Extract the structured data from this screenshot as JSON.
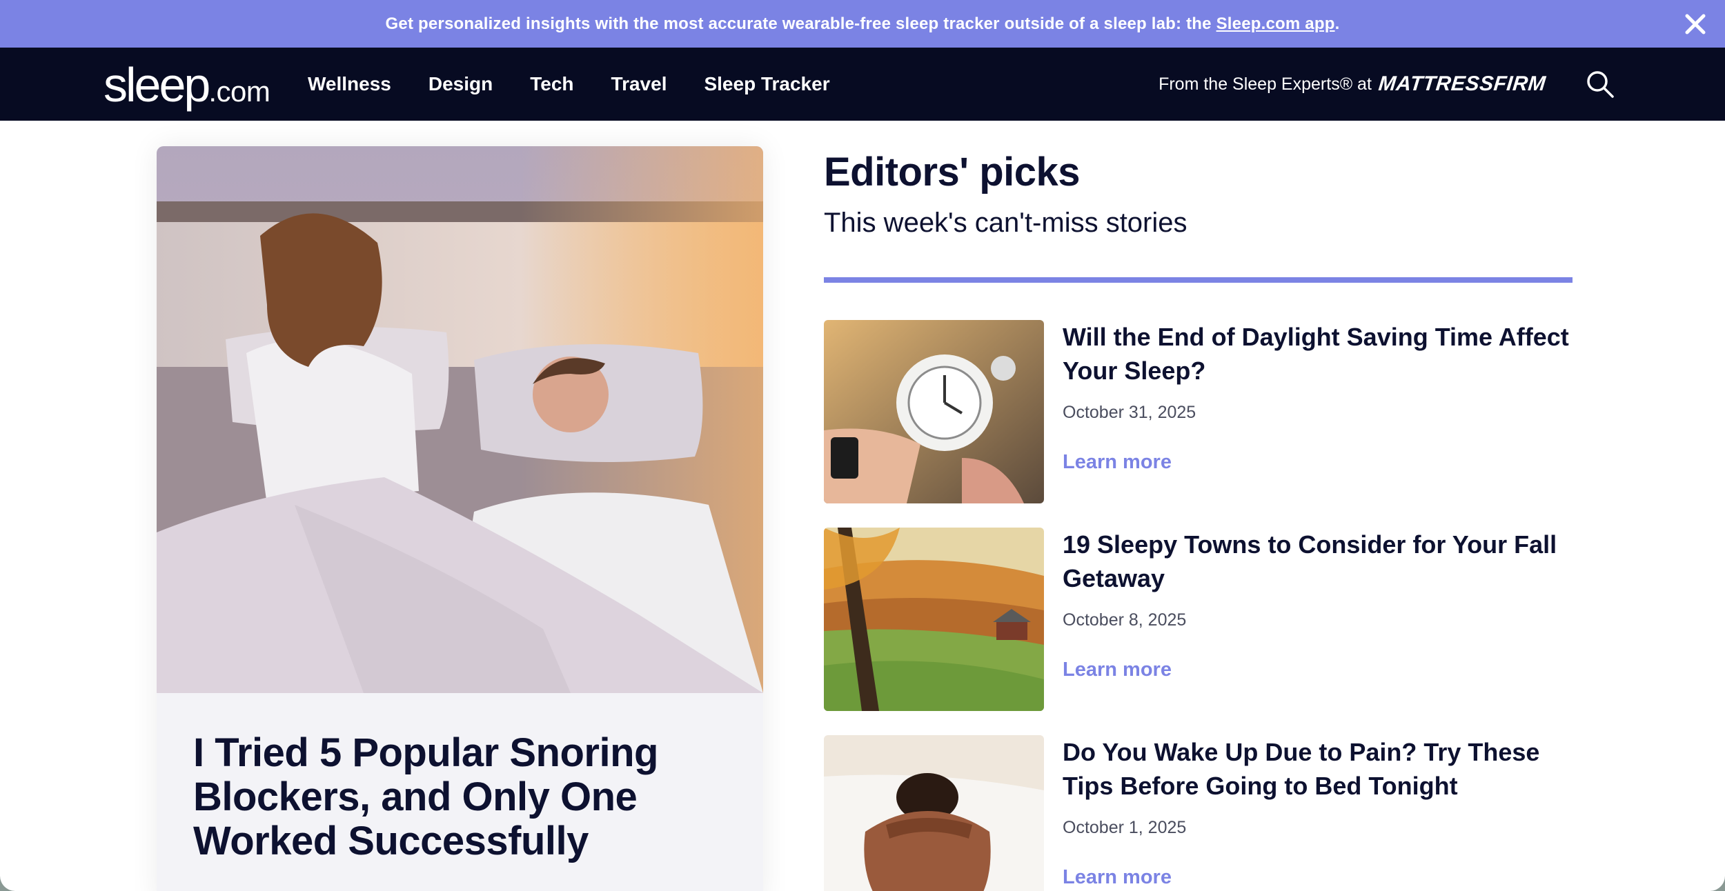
{
  "promo": {
    "text": "Get personalized insights with the most accurate wearable-free sleep tracker outside of a sleep lab: the ",
    "link": "Sleep.com app",
    "suffix": "."
  },
  "nav": {
    "logo_main": "sleep",
    "logo_tld": ".com",
    "links": [
      "Wellness",
      "Design",
      "Tech",
      "Travel",
      "Sleep Tracker"
    ],
    "partner_text": "From the Sleep Experts® at",
    "partner_brand": "MATTRESSFIRM"
  },
  "hero": {
    "title": "I Tried 5 Popular Snoring Blockers, and Only One Worked Successfully"
  },
  "picks": {
    "title": "Editors' picks",
    "subtitle": "This week's can't-miss stories",
    "items": [
      {
        "title": "Will the End of Daylight Saving Time Affect Your Sleep?",
        "date": "October 31, 2025",
        "cta": "Learn more"
      },
      {
        "title": "19 Sleepy Towns to Consider for Your Fall Getaway",
        "date": "October 8, 2025",
        "cta": "Learn more"
      },
      {
        "title": "Do You Wake Up Due to Pain? Try These Tips Before Going to Bed Tonight",
        "date": "October 1, 2025",
        "cta": "Learn more"
      }
    ]
  },
  "icons": {
    "close": "close-icon",
    "search": "search-icon"
  },
  "colors": {
    "accent": "#7b83e4",
    "nav_bg": "#070b22",
    "text": "#0d1130"
  }
}
